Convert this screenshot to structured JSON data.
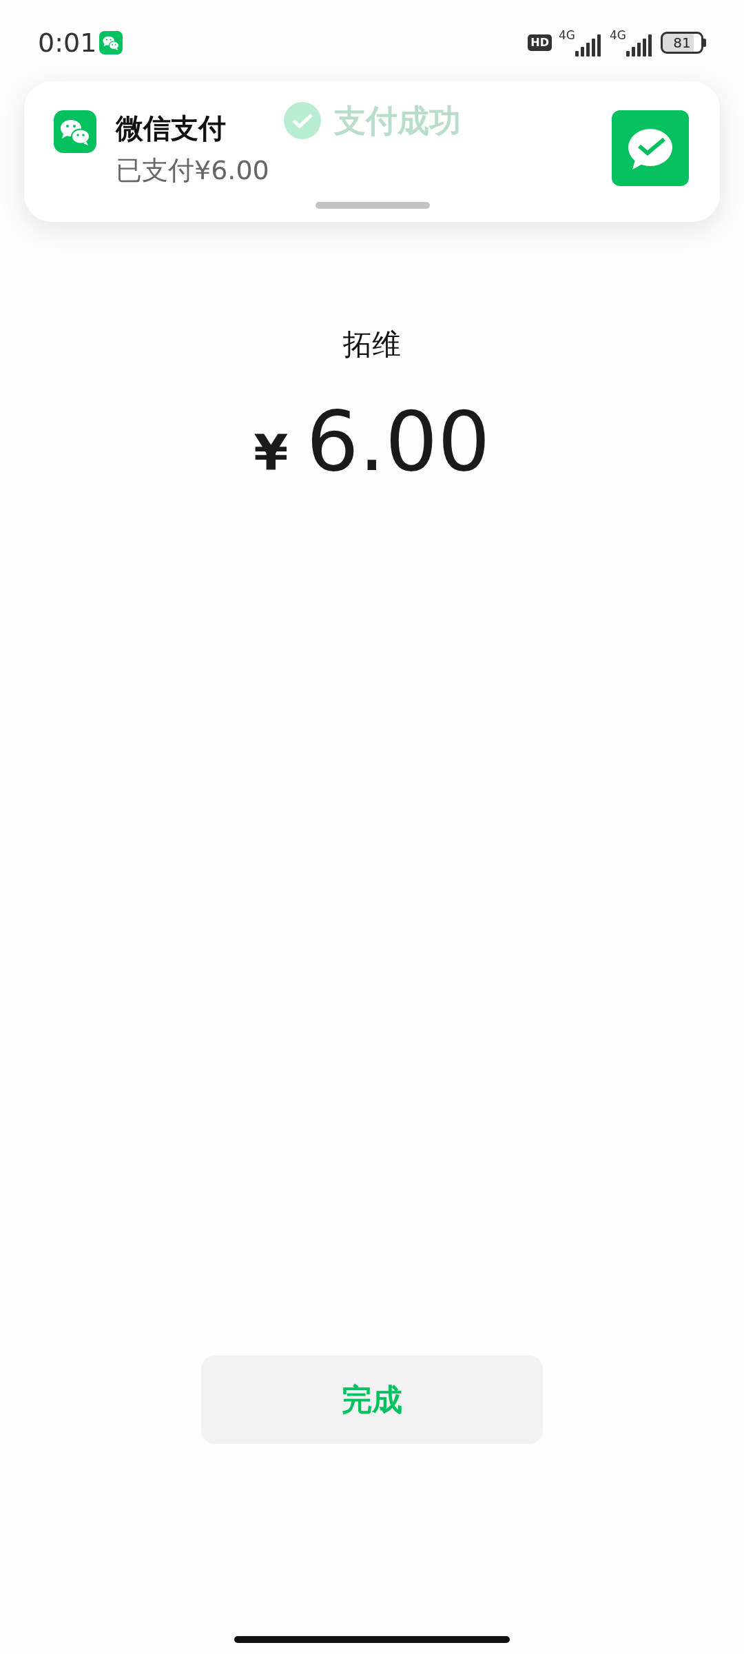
{
  "status_bar": {
    "time": "0:01",
    "hd_badge": "HD",
    "network_1": "4G",
    "network_2": "4G",
    "battery": "81"
  },
  "page": {
    "title": "支付成功",
    "merchant": "拓维",
    "currency": "¥",
    "amount": "6.00",
    "done_button": "完成"
  },
  "notification": {
    "app": "微信支付",
    "message": "已支付¥6.00"
  }
}
